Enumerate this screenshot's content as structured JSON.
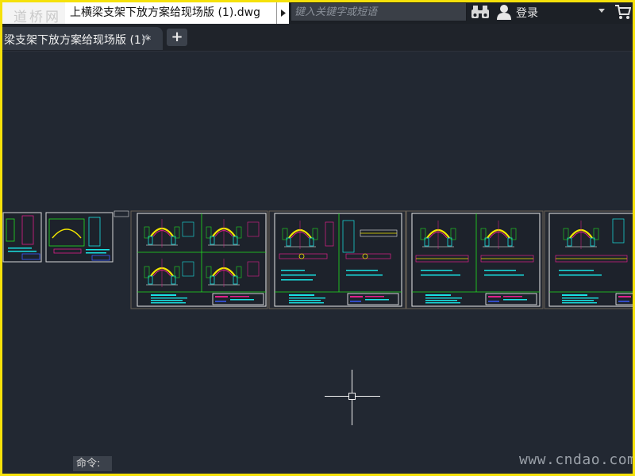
{
  "app": {
    "logo_text": "道桥网",
    "file_title": "上横梁支架下放方案给现场版 (1).dwg",
    "search_placeholder": "键入关键字或短语",
    "login_label": "登录"
  },
  "tabs": [
    {
      "label": "梁支架下放方案给现场版 (1)*",
      "close": "×"
    }
  ],
  "add_tab": "+",
  "command": {
    "label": "命令:"
  },
  "watermark": "www.cndao.com",
  "colors": {
    "accent_border": "#f5e10a",
    "canvas_bg": "#222832"
  },
  "icons": [
    "play-icon",
    "binoculars-icon",
    "user-icon",
    "chevron-down-icon",
    "cart-icon",
    "close-icon",
    "plus-icon",
    "crosshair-cursor"
  ]
}
